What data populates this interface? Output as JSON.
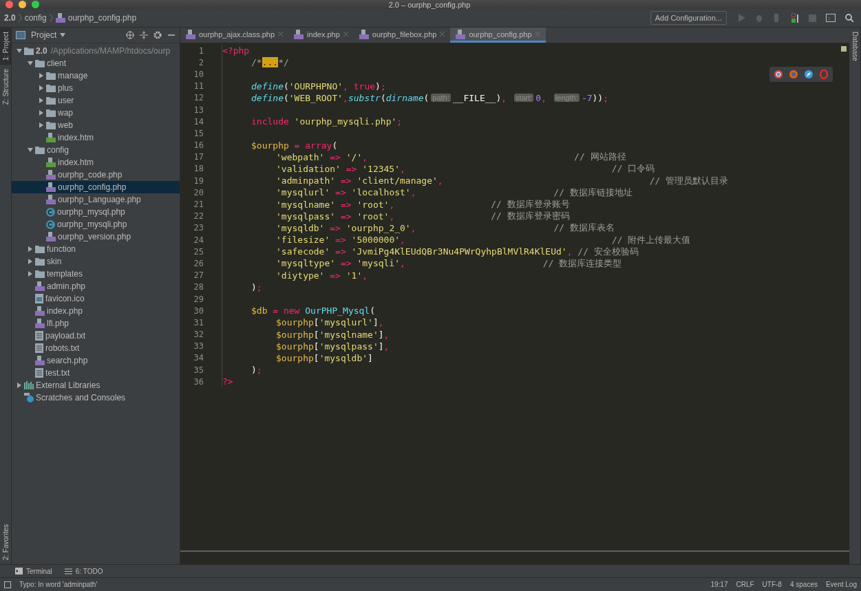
{
  "window": {
    "title": "2.0 – ourphp_config.php"
  },
  "breadcrumbs": [
    {
      "label": "2.0",
      "kind": "root"
    },
    {
      "label": "config",
      "kind": "folder"
    },
    {
      "label": "ourphp_config.php",
      "kind": "php"
    }
  ],
  "run_toolbar": {
    "config_button": "Add Configuration..."
  },
  "left_strip": [
    {
      "label": "1: Project",
      "selected": true
    },
    {
      "label": "Z: Structure",
      "selected": false
    }
  ],
  "left_strip_bottom": [
    {
      "label": "2: Favorites",
      "selected": false
    }
  ],
  "right_strip": [
    {
      "label": "Database",
      "selected": false
    }
  ],
  "project_panel": {
    "title": "Project",
    "tree": [
      {
        "label": "2.0",
        "path": "/Applications/MAMP/htdocs/ourp",
        "kind": "folder",
        "expanded": true,
        "selected": false,
        "children": [
          {
            "label": "client",
            "kind": "folder",
            "expanded": true,
            "selected": false,
            "children": [
              {
                "label": "manage",
                "kind": "folder",
                "expanded": false,
                "selected": false
              },
              {
                "label": "plus",
                "kind": "folder",
                "expanded": false,
                "selected": false
              },
              {
                "label": "user",
                "kind": "folder",
                "expanded": false,
                "selected": false
              },
              {
                "label": "wap",
                "kind": "folder",
                "expanded": false,
                "selected": false
              },
              {
                "label": "web",
                "kind": "folder",
                "expanded": false,
                "selected": false
              },
              {
                "label": "index.htm",
                "kind": "html",
                "selected": false
              }
            ]
          },
          {
            "label": "config",
            "kind": "folder",
            "expanded": true,
            "selected": false,
            "children": [
              {
                "label": "index.htm",
                "kind": "html",
                "selected": false
              },
              {
                "label": "ourphp_code.php",
                "kind": "php",
                "selected": false
              },
              {
                "label": "ourphp_config.php",
                "kind": "php",
                "selected": true
              },
              {
                "label": "ourphp_Language.php",
                "kind": "php",
                "selected": false
              },
              {
                "label": "ourphp_mysql.php",
                "kind": "class",
                "selected": false
              },
              {
                "label": "ourphp_mysqli.php",
                "kind": "class",
                "selected": false
              },
              {
                "label": "ourphp_version.php",
                "kind": "php",
                "selected": false
              }
            ]
          },
          {
            "label": "function",
            "kind": "folder",
            "expanded": false,
            "selected": false
          },
          {
            "label": "skin",
            "kind": "folder",
            "expanded": false,
            "selected": false
          },
          {
            "label": "templates",
            "kind": "folder",
            "expanded": false,
            "selected": false
          },
          {
            "label": "admin.php",
            "kind": "php",
            "selected": false
          },
          {
            "label": "favicon.ico",
            "kind": "image",
            "selected": false
          },
          {
            "label": "index.php",
            "kind": "php",
            "selected": false
          },
          {
            "label": "lfi.php",
            "kind": "php",
            "selected": false
          },
          {
            "label": "payload.txt",
            "kind": "text",
            "selected": false
          },
          {
            "label": "robots.txt",
            "kind": "text",
            "selected": false
          },
          {
            "label": "search.php",
            "kind": "php",
            "selected": false
          },
          {
            "label": "test.txt",
            "kind": "text",
            "selected": false
          }
        ]
      },
      {
        "label": "External Libraries",
        "kind": "library",
        "expanded": false,
        "selected": false
      },
      {
        "label": "Scratches and Consoles",
        "kind": "scratch",
        "selected": false
      }
    ]
  },
  "editor_tabs": [
    {
      "label": "ourphp_ajax.class.php",
      "selected": false
    },
    {
      "label": "index.php",
      "selected": false
    },
    {
      "label": "ourphp_filebox.php",
      "selected": false
    },
    {
      "label": "ourphp_config.php",
      "selected": true
    }
  ],
  "code": [
    {
      "no": "1",
      "kind": "top",
      "tokens": [
        {
          "kind": "tag",
          "text": "<?php"
        }
      ]
    },
    {
      "no": "2",
      "kind": "body",
      "tokens": [
        {
          "kind": "comment",
          "text": "/*"
        },
        {
          "kind": "fold",
          "text": "..."
        },
        {
          "kind": "comment",
          "text": "*/"
        }
      ]
    },
    {
      "no": "10",
      "kind": "blank"
    },
    {
      "no": "11",
      "kind": "body",
      "tokens": [
        {
          "kind": "func",
          "text": "define"
        },
        {
          "kind": "plain",
          "text": "("
        },
        {
          "kind": "string",
          "text": "'OURPHPNO'"
        },
        {
          "kind": "op",
          "text": ", "
        },
        {
          "kind": "keyword",
          "text": "true"
        },
        {
          "kind": "plain",
          "text": ")"
        },
        {
          "kind": "op",
          "text": ";"
        }
      ]
    },
    {
      "no": "12",
      "kind": "body",
      "tokens": [
        {
          "kind": "func",
          "text": "define"
        },
        {
          "kind": "plain",
          "text": "("
        },
        {
          "kind": "string",
          "text": "'WEB_ROOT'"
        },
        {
          "kind": "op",
          "text": ","
        },
        {
          "kind": "func",
          "text": "substr"
        },
        {
          "kind": "plain",
          "text": "("
        },
        {
          "kind": "func",
          "text": "dirname"
        },
        {
          "kind": "plain",
          "text": "("
        },
        {
          "kind": "hint",
          "text": "path:"
        },
        {
          "kind": "plain",
          "text": "__FILE__)"
        },
        {
          "kind": "op",
          "text": ", "
        },
        {
          "kind": "hint",
          "text": "start:"
        },
        {
          "kind": "number",
          "text": "0"
        },
        {
          "kind": "op",
          "text": ", "
        },
        {
          "kind": "hint",
          "text": "length:"
        },
        {
          "kind": "number",
          "text": "-7"
        },
        {
          "kind": "plain",
          "text": "))"
        },
        {
          "kind": "op",
          "text": ";"
        }
      ]
    },
    {
      "no": "13",
      "kind": "blank"
    },
    {
      "no": "14",
      "kind": "body",
      "tokens": [
        {
          "kind": "keyword",
          "text": "include"
        },
        {
          "kind": "string",
          "text": " 'ourphp_mysqli.php'"
        },
        {
          "kind": "op",
          "text": ";"
        }
      ]
    },
    {
      "no": "15",
      "kind": "blank"
    },
    {
      "no": "16",
      "kind": "body",
      "tokens": [
        {
          "kind": "var",
          "text": "$ourphp"
        },
        {
          "kind": "op",
          "text": " = "
        },
        {
          "kind": "keyword",
          "text": "array"
        },
        {
          "kind": "plain",
          "text": "("
        }
      ]
    },
    {
      "no": "17",
      "kind": "inner",
      "tokens": [
        {
          "kind": "string",
          "text": "'webpath'"
        },
        {
          "kind": "op",
          "text": " => "
        },
        {
          "kind": "string",
          "text": "'/'"
        },
        {
          "kind": "op",
          "text": ","
        },
        {
          "kind": "comment_far",
          "text": "// 网站路径"
        }
      ]
    },
    {
      "no": "18",
      "kind": "inner",
      "tokens": [
        {
          "kind": "string",
          "text": "'validation'"
        },
        {
          "kind": "op",
          "text": " => "
        },
        {
          "kind": "string",
          "text": "'12345'"
        },
        {
          "kind": "op",
          "text": ","
        },
        {
          "kind": "comment_far",
          "text": "// 口令码"
        }
      ]
    },
    {
      "no": "19",
      "kind": "inner",
      "tokens": [
        {
          "kind": "string",
          "text": "'adminpath'"
        },
        {
          "kind": "op",
          "text": " => "
        },
        {
          "kind": "string",
          "text": "'client/manage'"
        },
        {
          "kind": "op",
          "text": ","
        },
        {
          "kind": "comment_far",
          "text": "// 管理员默认目录"
        }
      ]
    },
    {
      "no": "20",
      "kind": "inner",
      "tokens": [
        {
          "kind": "string",
          "text": "'mysqlurl'"
        },
        {
          "kind": "op",
          "text": " => "
        },
        {
          "kind": "string",
          "text": "'localhost'"
        },
        {
          "kind": "op",
          "text": ","
        },
        {
          "kind": "comment_mid",
          "text": "// 数据库链接地址"
        }
      ]
    },
    {
      "no": "21",
      "kind": "inner",
      "tokens": [
        {
          "kind": "string",
          "text": "'mysqlname'"
        },
        {
          "kind": "op",
          "text": " => "
        },
        {
          "kind": "string",
          "text": "'root'"
        },
        {
          "kind": "op",
          "text": ","
        },
        {
          "kind": "comment_near",
          "text": "// 数据库登录账号"
        }
      ]
    },
    {
      "no": "22",
      "kind": "inner",
      "tokens": [
        {
          "kind": "string",
          "text": "'mysqlpass'"
        },
        {
          "kind": "op",
          "text": " => "
        },
        {
          "kind": "string",
          "text": "'root'"
        },
        {
          "kind": "op",
          "text": ","
        },
        {
          "kind": "comment_near",
          "text": "// 数据库登录密码"
        }
      ]
    },
    {
      "no": "23",
      "kind": "inner",
      "tokens": [
        {
          "kind": "string",
          "text": "'mysqldb'"
        },
        {
          "kind": "op",
          "text": " => "
        },
        {
          "kind": "string",
          "text": "'ourphp_2_0'"
        },
        {
          "kind": "op",
          "text": ","
        },
        {
          "kind": "comment_mid",
          "text": "// 数据库表名"
        }
      ]
    },
    {
      "no": "24",
      "kind": "inner",
      "tokens": [
        {
          "kind": "string",
          "text": "'filesize'"
        },
        {
          "kind": "op",
          "text": " => "
        },
        {
          "kind": "string",
          "text": "'5000000'"
        },
        {
          "kind": "op",
          "text": ","
        },
        {
          "kind": "comment_far",
          "text": "// 附件上传最大值"
        }
      ]
    },
    {
      "no": "25",
      "kind": "inner",
      "tokens": [
        {
          "kind": "string",
          "text": "'safecode'"
        },
        {
          "kind": "op",
          "text": " => "
        },
        {
          "kind": "string",
          "text": "'JvmiPg4KlEUdQBr3Nu4PWrQyhpBlMVlR4KlEUd'"
        },
        {
          "kind": "op",
          "text": ","
        },
        {
          "kind": "comment",
          "text": " // 安全校验码"
        }
      ]
    },
    {
      "no": "26",
      "kind": "inner",
      "tokens": [
        {
          "kind": "string",
          "text": "'mysqltype'"
        },
        {
          "kind": "op",
          "text": " => "
        },
        {
          "kind": "string",
          "text": "'mysqli'"
        },
        {
          "kind": "op",
          "text": ","
        },
        {
          "kind": "comment_mid",
          "text": "// 数据库连接类型"
        }
      ]
    },
    {
      "no": "27",
      "kind": "inner",
      "tokens": [
        {
          "kind": "string",
          "text": "'diytype'"
        },
        {
          "kind": "op",
          "text": " => "
        },
        {
          "kind": "string",
          "text": "'1'"
        },
        {
          "kind": "op",
          "text": ","
        }
      ]
    },
    {
      "no": "28",
      "kind": "body",
      "tokens": [
        {
          "kind": "plain",
          "text": ")"
        },
        {
          "kind": "op",
          "text": ";"
        }
      ]
    },
    {
      "no": "29",
      "kind": "blank"
    },
    {
      "no": "30",
      "kind": "body",
      "tokens": [
        {
          "kind": "var",
          "text": "$db"
        },
        {
          "kind": "op",
          "text": " = "
        },
        {
          "kind": "keyword",
          "text": "new"
        },
        {
          "kind": "class",
          "text": " OurPHP_Mysql"
        },
        {
          "kind": "plain",
          "text": "("
        }
      ]
    },
    {
      "no": "31",
      "kind": "inner",
      "tokens": [
        {
          "kind": "var",
          "text": "$ourphp"
        },
        {
          "kind": "plain",
          "text": "["
        },
        {
          "kind": "string",
          "text": "'mysqlurl'"
        },
        {
          "kind": "plain",
          "text": "]"
        },
        {
          "kind": "op",
          "text": ","
        }
      ]
    },
    {
      "no": "32",
      "kind": "inner",
      "tokens": [
        {
          "kind": "var",
          "text": "$ourphp"
        },
        {
          "kind": "plain",
          "text": "["
        },
        {
          "kind": "string",
          "text": "'mysqlname'"
        },
        {
          "kind": "plain",
          "text": "]"
        },
        {
          "kind": "op",
          "text": ","
        }
      ]
    },
    {
      "no": "33",
      "kind": "inner",
      "tokens": [
        {
          "kind": "var",
          "text": "$ourphp"
        },
        {
          "kind": "plain",
          "text": "["
        },
        {
          "kind": "string",
          "text": "'mysqlpass'"
        },
        {
          "kind": "plain",
          "text": "]"
        },
        {
          "kind": "op",
          "text": ","
        }
      ]
    },
    {
      "no": "34",
      "kind": "inner",
      "tokens": [
        {
          "kind": "var",
          "text": "$ourphp"
        },
        {
          "kind": "plain",
          "text": "["
        },
        {
          "kind": "string",
          "text": "'mysqldb'"
        },
        {
          "kind": "plain",
          "text": "]"
        }
      ]
    },
    {
      "no": "35",
      "kind": "body",
      "tokens": [
        {
          "kind": "plain",
          "text": ")"
        },
        {
          "kind": "op",
          "text": ";"
        }
      ]
    },
    {
      "no": "36",
      "kind": "top",
      "tokens": [
        {
          "kind": "tag",
          "text": "?>"
        }
      ]
    }
  ],
  "bottom_tools": [
    {
      "label": "Terminal",
      "kind": "terminal"
    },
    {
      "label": "6: TODO",
      "kind": "todo"
    }
  ],
  "status_bar": {
    "message": "Typo: In word 'adminpath'",
    "position": "19:17",
    "line_ending": "CRLF",
    "encoding": "UTF-8",
    "indent": "4 spaces",
    "event_log": "Event Log"
  }
}
